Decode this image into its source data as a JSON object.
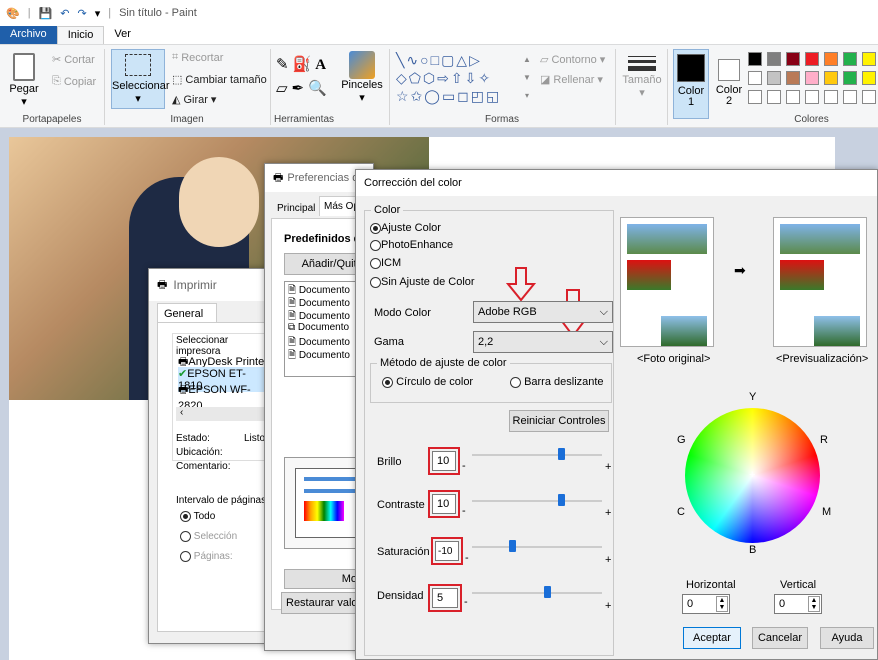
{
  "app": {
    "title": "Sin título - Paint"
  },
  "menu": [
    "Archivo",
    "Inicio",
    "Ver"
  ],
  "ribbon": {
    "paste": "Pegar",
    "cut": "Cortar",
    "copy": "Copiar",
    "clipboard": "Portapapeles",
    "select": "Seleccionar",
    "crop": "Recortar",
    "resize": "Cambiar tamaño",
    "rotate": "Girar",
    "image": "Imagen",
    "tools": "Herramientas",
    "brushes": "Pinceles",
    "shapes": "Formas",
    "outline": "Contorno",
    "fill": "Rellenar",
    "size": "Tamaño",
    "color1": "Color\n1",
    "color2": "Color\n2",
    "colors": "Colores",
    "palette": [
      "#000000",
      "#7f7f7f",
      "#880015",
      "#ed1c24",
      "#ff7f27",
      "#ffffff",
      "#c3c3c3",
      "#b97a57",
      "#ffaec9",
      "#ffc90e"
    ]
  },
  "print": {
    "title": "Imprimir",
    "tab": "General",
    "printer_label": "Seleccionar impresora",
    "printers": [
      "AnyDesk Printer",
      "EPSON ET-1810",
      "EPSON WF-2820"
    ],
    "status_label": "Estado:",
    "status_val": "Listo",
    "location_label": "Ubicación:",
    "comment_label": "Comentario:",
    "range_label": "Intervalo de páginas",
    "all": "Todo",
    "selection": "Selección",
    "pages": "Páginas:"
  },
  "prefs": {
    "title": "Preferencias de impresión",
    "tab1": "Principal",
    "tab2": "Más Opciones",
    "presets": "Predefinidos de impresión",
    "add": "Añadir/Quitar",
    "docs": [
      "Documento",
      "Documento",
      "Documento",
      "Documento",
      "Documento",
      "Documento"
    ],
    "show": "Mostrar",
    "restore": "Restaurar valores"
  },
  "color": {
    "title": "Corrección del color",
    "group": "Color",
    "opt_adjust": "Ajuste Color",
    "opt_photo": "PhotoEnhance",
    "opt_icm": "ICM",
    "opt_none": "Sin Ajuste de Color",
    "mode_label": "Modo Color",
    "mode_val": "Adobe RGB",
    "gamma_label": "Gama",
    "gamma_val": "2,2",
    "method_label": "Método de ajuste de color",
    "method_circle": "Círculo de color",
    "method_slider": "Barra deslizante",
    "reset": "Reiniciar Controles",
    "brightness_label": "Brillo",
    "brightness": "10",
    "contrast_label": "Contraste",
    "contrast": "10",
    "saturation_label": "Saturación",
    "saturation": "-10",
    "density_label": "Densidad",
    "density": "5",
    "minus": "-",
    "plus": "+",
    "original": "<Foto original>",
    "preview": "<Previsualización>",
    "wheel_labels": {
      "Y": "Y",
      "R": "R",
      "M": "M",
      "B": "B",
      "C": "C",
      "G": "G",
      "center": "+"
    },
    "horizontal_label": "Horizontal",
    "horizontal": "0",
    "vertical_label": "Vertical",
    "vertical": "0",
    "ok": "Aceptar",
    "cancel": "Cancelar",
    "help": "Ayuda"
  }
}
